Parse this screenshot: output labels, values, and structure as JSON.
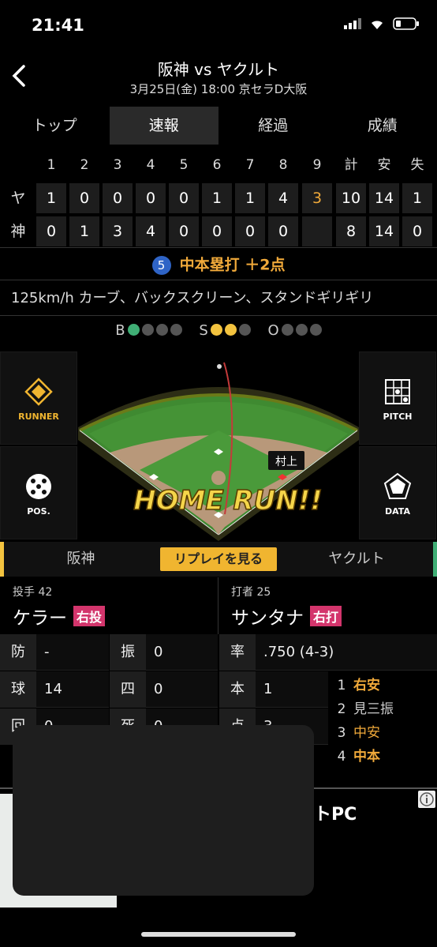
{
  "status": {
    "time": "21:41"
  },
  "header": {
    "title": "阪神 vs ヤクルト",
    "subtitle": "3月25日(金) 18:00 京セラD大阪"
  },
  "tabs": [
    {
      "label": "トップ"
    },
    {
      "label": "速報",
      "active": true
    },
    {
      "label": "経過"
    },
    {
      "label": "成績"
    }
  ],
  "scoreboard": {
    "columns": [
      "1",
      "2",
      "3",
      "4",
      "5",
      "6",
      "7",
      "8",
      "9",
      "計",
      "安",
      "失"
    ],
    "rows": [
      {
        "team": "ヤ",
        "cells": [
          "1",
          "0",
          "0",
          "0",
          "0",
          "1",
          "1",
          "4",
          "3",
          "10",
          "14",
          "1"
        ]
      },
      {
        "team": "神",
        "cells": [
          "0",
          "1",
          "3",
          "4",
          "0",
          "0",
          "0",
          "0",
          "",
          "8",
          "14",
          "0"
        ]
      }
    ]
  },
  "play": {
    "batter_number": "5",
    "text": "中本塁打 ＋2点"
  },
  "pitch_desc": "125km/h カーブ、バックスクリーン、スタンドギリギリ",
  "count": {
    "b_label": "B",
    "s_label": "S",
    "o_label": "O",
    "balls": 1,
    "strikes": 2,
    "outs": 0
  },
  "field": {
    "runner_label": "RUNNER",
    "pos_label": "POS.",
    "pitch_label": "PITCH",
    "data_label": "DATA",
    "fielder_name": "村上",
    "banner": "HOME RUN!!"
  },
  "teambar": {
    "home": "阪神",
    "replay": "リプレイを見る",
    "away": "ヤクルト"
  },
  "pitcher": {
    "role": "投手",
    "number": "42",
    "name": "ケラー",
    "hand": "右投"
  },
  "batter": {
    "role": "打者",
    "number": "25",
    "name": "サンタナ",
    "hand": "右打"
  },
  "pitcher_stats": [
    {
      "k": "防",
      "v": "-"
    },
    {
      "k": "振",
      "v": "0"
    },
    {
      "k": "球",
      "v": "14"
    },
    {
      "k": "四",
      "v": "0"
    },
    {
      "k": "回",
      "v": "0"
    },
    {
      "k": "死",
      "v": "0"
    }
  ],
  "batter_stats": [
    {
      "k": "率",
      "v": ".750 (4-3)"
    },
    {
      "k": "本",
      "v": "1"
    },
    {
      "k": "点",
      "v": "3"
    }
  ],
  "batter_history": [
    {
      "n": "1",
      "r": "右安",
      "hit": true
    },
    {
      "n": "2",
      "r": "見三振",
      "hit": false
    },
    {
      "n": "3",
      "r": "中安",
      "hit": true
    },
    {
      "n": "4",
      "r": "中本",
      "hit": true
    }
  ],
  "ad": {
    "text": "ートPC"
  }
}
